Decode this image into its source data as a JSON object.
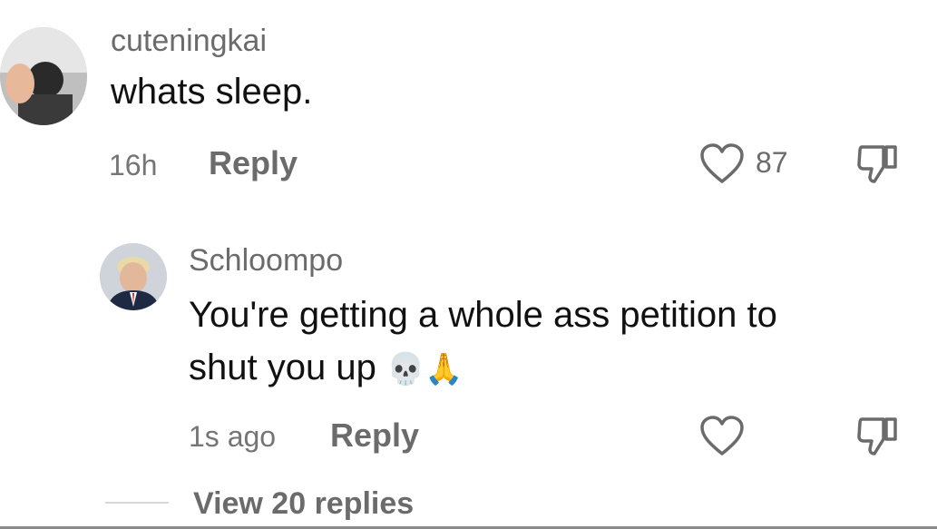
{
  "comments": [
    {
      "username": "cuteningkai",
      "text": "whats sleep.",
      "time": "16h",
      "reply_label": "Reply",
      "like_count": "87"
    },
    {
      "username": "Schloompo",
      "text_line1": "You're getting a whole ass petition to",
      "text_line2": "shut you up",
      "emojis": "💀🙏",
      "time": "1s ago",
      "reply_label": "Reply"
    }
  ],
  "view_replies": "View 20 replies",
  "colors": {
    "text_primary": "#111111",
    "text_secondary": "#6b6b6b"
  }
}
